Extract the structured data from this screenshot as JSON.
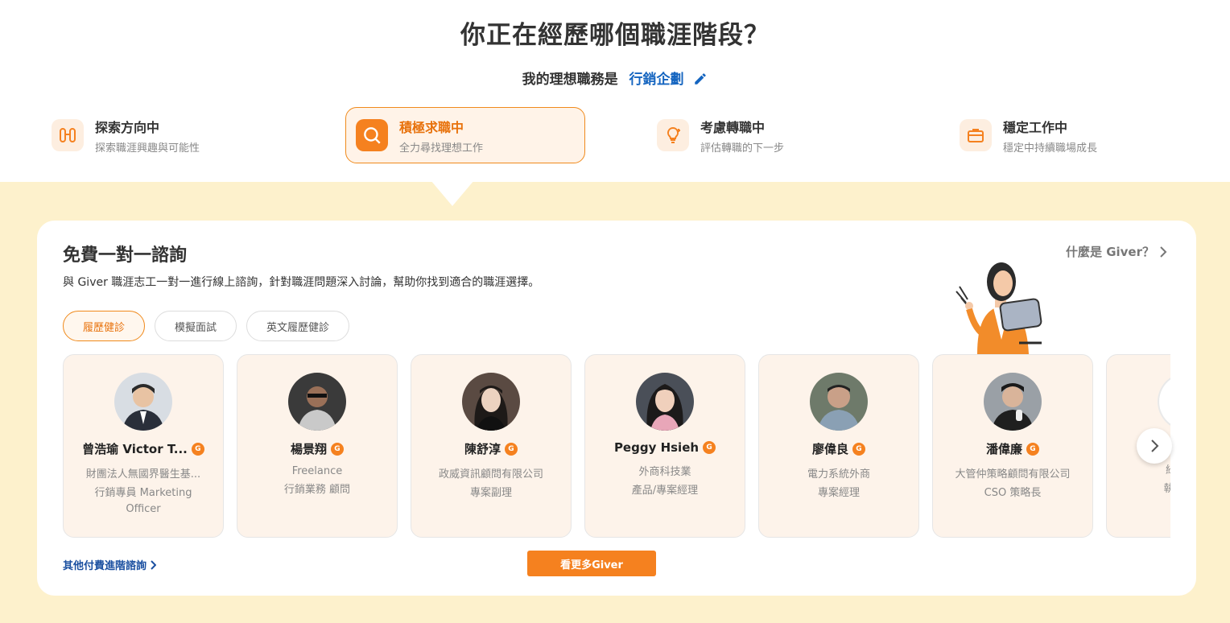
{
  "page_title": "你正在經歷哪個職涯階段？",
  "ideal_job": {
    "label": "我的理想職務是",
    "value": "行銷企劃"
  },
  "stages": [
    {
      "title": "探索方向中",
      "subtitle": "探索職涯興趣與可能性",
      "icon": "binoculars-icon"
    },
    {
      "title": "積極求職中",
      "subtitle": "全力尋找理想工作",
      "icon": "search-icon",
      "active": true
    },
    {
      "title": "考慮轉職中",
      "subtitle": "評估轉職的下一步",
      "icon": "lightbulb-icon"
    },
    {
      "title": "穩定工作中",
      "subtitle": "穩定中持續職場成長",
      "icon": "briefcase-icon"
    }
  ],
  "consult": {
    "title": "免費一對一諮詢",
    "description": "與 Giver 職涯志工一對一進行線上諮詢，針對職涯問題深入討論，幫助你找到適合的職涯選擇。",
    "what_is_giver": "什麼是 Giver？",
    "tabs": [
      "履歷健診",
      "模擬面試",
      "英文履歷健診"
    ],
    "active_tab": "履歷健診",
    "badge_letter": "G",
    "givers": [
      {
        "name": "曾浩瑜 Victor T...",
        "org": "財團法人無國界醫生基...",
        "role": "行銷專員 Marketing Officer"
      },
      {
        "name": "楊景翔",
        "org": "Freelance",
        "role": "行銷業務 顧問"
      },
      {
        "name": "陳舒淳",
        "org": "政威資訊顧問有限公司",
        "role": "專案副理"
      },
      {
        "name": "Peggy Hsieh",
        "org": "外商科技業",
        "role": "產品/專案經理"
      },
      {
        "name": "廖偉良",
        "org": "電力系統外商",
        "role": "專案經理"
      },
      {
        "name": "潘偉廉",
        "org": "大管仲策略顧問有限公司",
        "role": "CSO 策略長"
      },
      {
        "name": "",
        "org": "綠薈行匯",
        "role": "執行長(兩"
      }
    ],
    "other_link": "其他付費進階諮詢",
    "more_button": "看更多Giver"
  },
  "colors": {
    "accent": "#f5811f",
    "link": "#1565c0",
    "band": "#fdf1cc",
    "card": "#fdf3ea"
  }
}
